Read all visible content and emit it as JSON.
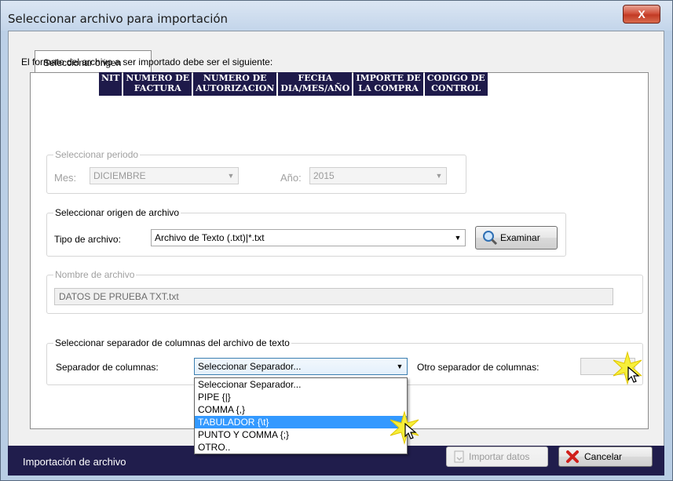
{
  "window": {
    "title": "Seleccionar archivo para importación",
    "close_label": "X"
  },
  "tab": {
    "label": "Seleccionar origen"
  },
  "format": {
    "intro": "El formato del archivo a ser importado debe ser el siguiente:",
    "columns": [
      "NIT",
      "NUMERO DE\nFACTURA",
      "NUMERO DE\nAUTORIZACION",
      "FECHA\nDIA/MES/AÑO",
      "IMPORTE DE\nLA COMPRA",
      "CODIGO DE\nCONTROL"
    ]
  },
  "periodo": {
    "legend": "Seleccionar periodo",
    "mes_label": "Mes:",
    "mes_value": "DICIEMBRE",
    "anio_label": "Año:",
    "anio_value": "2015"
  },
  "origen": {
    "legend": "Seleccionar origen de archivo",
    "tipo_label": "Tipo de archivo:",
    "tipo_value": "Archivo de Texto (.txt)|*.txt",
    "examinar_label": "Examinar"
  },
  "nombre": {
    "legend": "Nombre de archivo",
    "value": "DATOS DE PRUEBA TXT.txt"
  },
  "separador": {
    "legend": "Seleccionar separador de columnas del archivo de texto",
    "label": "Separador de columnas:",
    "selected": "Seleccionar Separador...",
    "otro_label": "Otro separador de columnas:",
    "otro_value": "",
    "options": [
      "Seleccionar Separador...",
      "PIPE {|}",
      "COMMA {,}",
      "TABULADOR {\\t}",
      "PUNTO Y COMMA {;}",
      "OTRO.."
    ],
    "highlighted_option": "TABULADOR {\\t}"
  },
  "footer": {
    "status": "Importación de archivo",
    "importar_label": "Importar datos",
    "cancelar_label": "Cancelar"
  },
  "colors": {
    "status_bar": "#201d4c",
    "highlight": "#3399ff",
    "header_cells": "#1e1a4a"
  }
}
